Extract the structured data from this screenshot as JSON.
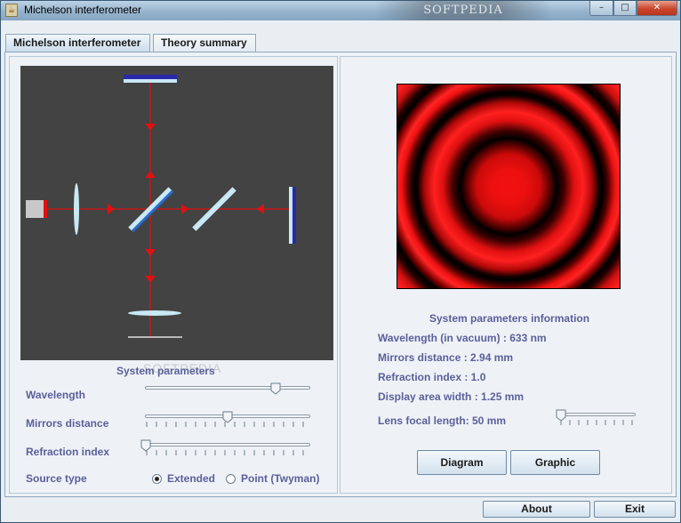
{
  "window": {
    "title": "Michelson interferometer",
    "watermark": "SOFTPEDIA",
    "controls": {
      "minimize": "–",
      "maximize": "□",
      "close": "✕"
    }
  },
  "tabs": [
    {
      "label": "Michelson interferometer",
      "selected": true
    },
    {
      "label": "Theory summary",
      "selected": false
    }
  ],
  "left": {
    "section_title": "System parameters",
    "overlay_credit": "SOFTPEDIA",
    "parameters": [
      {
        "label": "Wavelength",
        "slider_value": 0.8
      },
      {
        "label": "Mirrors distance",
        "slider_value": 0.5
      },
      {
        "label": "Refraction index",
        "slider_value": 0.0
      }
    ],
    "source_type": {
      "label": "Source type",
      "options": [
        {
          "label": "Extended",
          "selected": true
        },
        {
          "label": "Point (Twyman)",
          "selected": false
        }
      ]
    }
  },
  "right": {
    "section_title": "System parameters information",
    "info": {
      "wavelength": "Wavelength  (in vacuum) : 633 nm",
      "mirrors_distance": "Mirrors distance : 2.94 mm",
      "refraction_index": "Refraction index : 1.0",
      "display_area_width": "Display area width  : 1.25 mm",
      "lens_focal_length": "Lens focal length: 50 mm"
    },
    "focal_slider_value": 0.0,
    "buttons": {
      "diagram": "Diagram",
      "graphic": "Graphic"
    }
  },
  "footer": {
    "about": "About",
    "exit": "Exit"
  },
  "colors": {
    "label": "#5b5f9a",
    "diagram_bg": "#434343",
    "beam": "#e01010",
    "mirror": "#2a2aa8",
    "glass": "#c8e8f4"
  }
}
